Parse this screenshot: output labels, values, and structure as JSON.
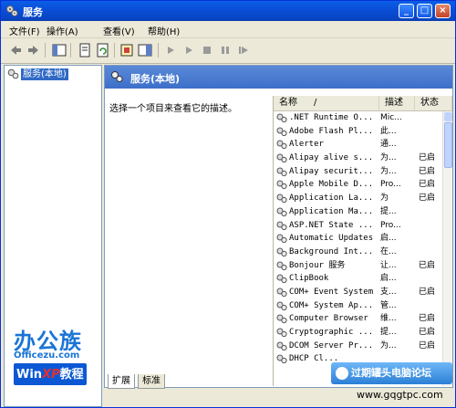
{
  "window": {
    "title": "服务",
    "minimize": "_",
    "maximize": "□",
    "close": "×"
  },
  "menu": [
    "文件(F)",
    "操作(A)",
    "查看(V)",
    "帮助(H)"
  ],
  "tree": {
    "root_label": "服务(本地)"
  },
  "panel": {
    "header": "服务(本地)",
    "description": "选择一个项目来查看它的描述。"
  },
  "columns": {
    "name": "名称",
    "sort_indicator": "/",
    "desc": "描述",
    "status": "状态"
  },
  "services": [
    {
      "name": ".NET Runtime O...",
      "desc": "Mic...",
      "status": ""
    },
    {
      "name": "Adobe Flash Pl...",
      "desc": "此...",
      "status": ""
    },
    {
      "name": "Alerter",
      "desc": "通...",
      "status": ""
    },
    {
      "name": "Alipay alive s...",
      "desc": "为...",
      "status": "已启"
    },
    {
      "name": "Alipay securit...",
      "desc": "为...",
      "status": "已启"
    },
    {
      "name": "Apple Mobile D...",
      "desc": "Pro...",
      "status": "已启"
    },
    {
      "name": "Application La...",
      "desc": "为",
      "status": "已启"
    },
    {
      "name": "Application Ma...",
      "desc": "提...",
      "status": ""
    },
    {
      "name": "ASP.NET State ...",
      "desc": "Pro...",
      "status": ""
    },
    {
      "name": "Automatic Updates",
      "desc": "启...",
      "status": ""
    },
    {
      "name": "Background Int...",
      "desc": "在...",
      "status": ""
    },
    {
      "name": "Bonjour 服务",
      "desc": "让...",
      "status": "已启"
    },
    {
      "name": "ClipBook",
      "desc": "启...",
      "status": ""
    },
    {
      "name": "COM+ Event System",
      "desc": "支...",
      "status": "已启"
    },
    {
      "name": "COM+ System Ap...",
      "desc": "管...",
      "status": ""
    },
    {
      "name": "Computer Browser",
      "desc": "维...",
      "status": "已启"
    },
    {
      "name": "Cryptographic ...",
      "desc": "提...",
      "status": "已启"
    },
    {
      "name": "DCOM Server Pr...",
      "desc": "为...",
      "status": "已启"
    },
    {
      "name": "DHCP Cl...",
      "desc": "",
      "status": ""
    }
  ],
  "tabs": [
    "扩展",
    "标准"
  ],
  "watermark": {
    "logo_cn": "办公族",
    "logo_url": "Officezu.com",
    "logo_win": "Win",
    "logo_xp": "XP",
    "logo_jc": "教程",
    "forum": "过期罐头电脑论坛",
    "site": "www.gqgtpc.com"
  }
}
